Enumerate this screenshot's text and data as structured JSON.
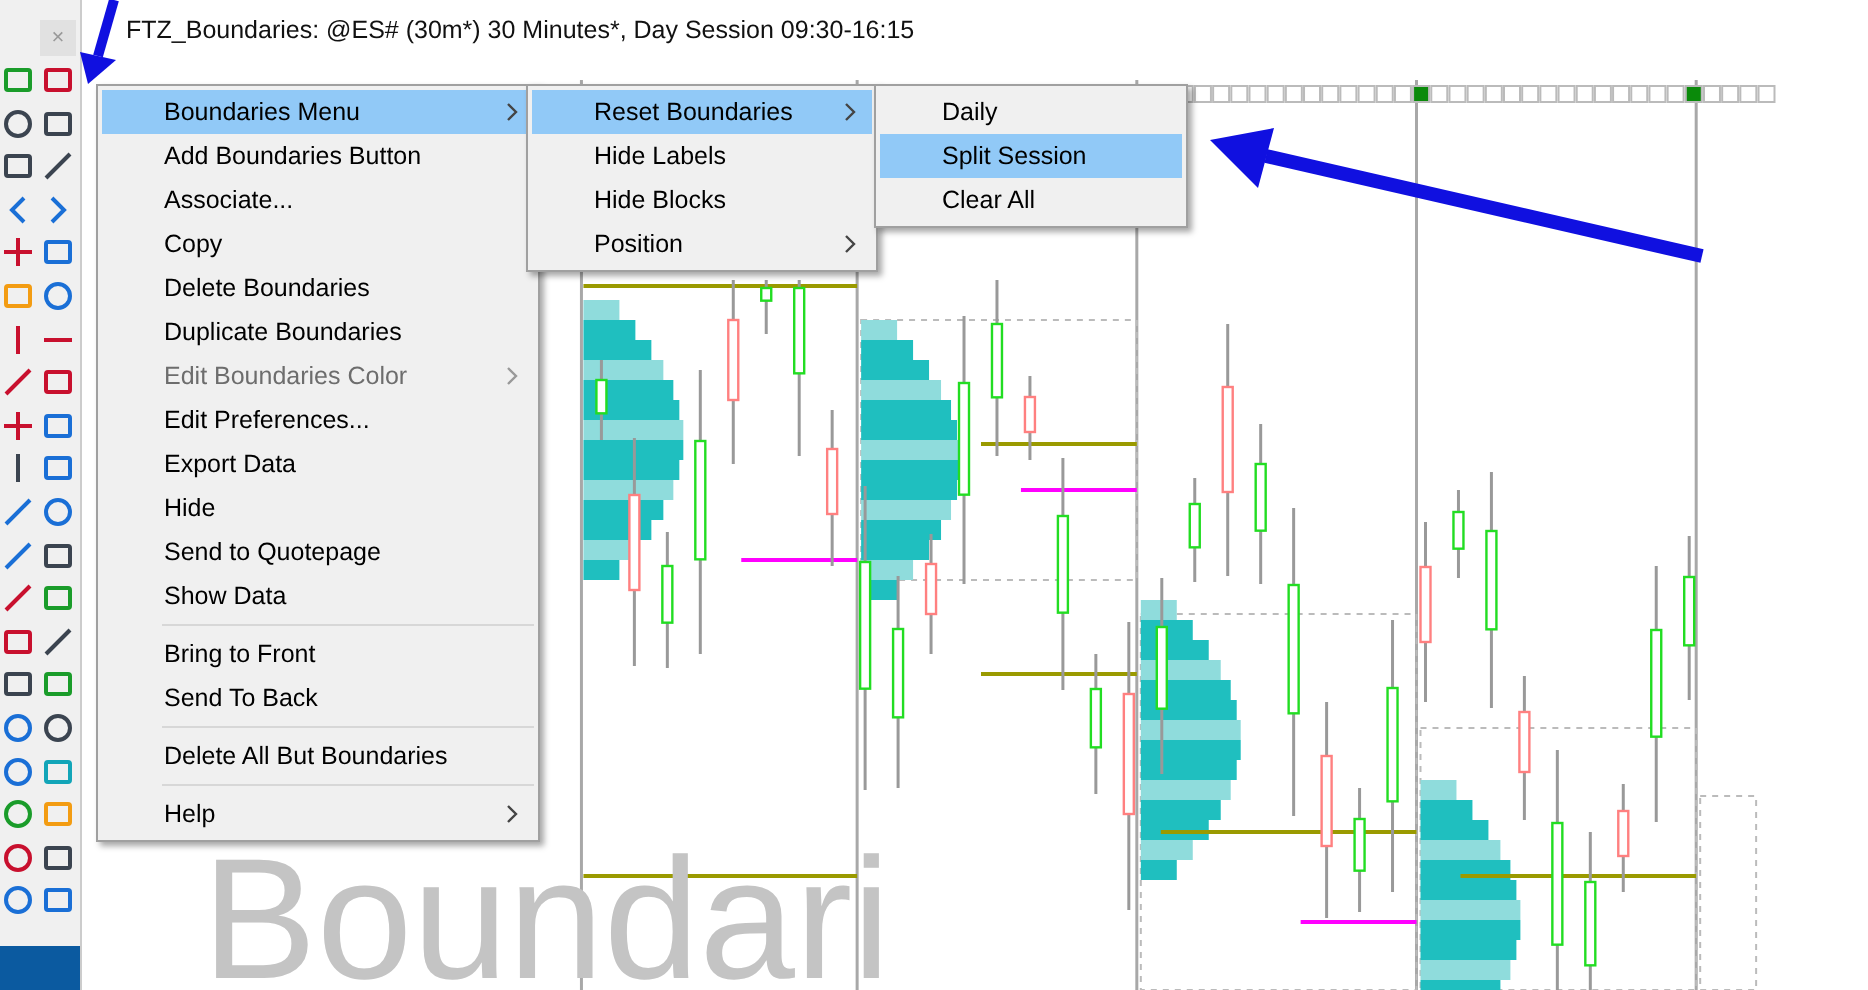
{
  "window": {
    "title": "FTZ_Boundaries: @ES# (30m*) 30 Minutes*, Day Session 09:30-16:15",
    "close_label": "×"
  },
  "context_menu": {
    "items": [
      {
        "kind": "item",
        "label": "Boundaries Menu",
        "selected": true,
        "disabled": false,
        "submenu": true
      },
      {
        "kind": "item",
        "label": "Add Boundaries Button",
        "selected": false,
        "disabled": false,
        "submenu": false
      },
      {
        "kind": "item",
        "label": "Associate...",
        "selected": false,
        "disabled": false,
        "submenu": false
      },
      {
        "kind": "item",
        "label": "Copy",
        "selected": false,
        "disabled": false,
        "submenu": false
      },
      {
        "kind": "item",
        "label": "Delete Boundaries",
        "selected": false,
        "disabled": false,
        "submenu": false
      },
      {
        "kind": "item",
        "label": "Duplicate Boundaries",
        "selected": false,
        "disabled": false,
        "submenu": false
      },
      {
        "kind": "item",
        "label": "Edit Boundaries Color",
        "selected": false,
        "disabled": true,
        "submenu": true
      },
      {
        "kind": "item",
        "label": "Edit Preferences...",
        "selected": false,
        "disabled": false,
        "submenu": false
      },
      {
        "kind": "item",
        "label": "Export Data",
        "selected": false,
        "disabled": false,
        "submenu": false
      },
      {
        "kind": "item",
        "label": "Hide",
        "selected": false,
        "disabled": false,
        "submenu": false
      },
      {
        "kind": "item",
        "label": "Send to Quotepage",
        "selected": false,
        "disabled": false,
        "submenu": false
      },
      {
        "kind": "item",
        "label": "Show Data",
        "selected": false,
        "disabled": false,
        "submenu": false
      },
      {
        "kind": "separator"
      },
      {
        "kind": "item",
        "label": "Bring to Front",
        "selected": false,
        "disabled": false,
        "submenu": false
      },
      {
        "kind": "item",
        "label": "Send To Back",
        "selected": false,
        "disabled": false,
        "submenu": false
      },
      {
        "kind": "separator"
      },
      {
        "kind": "item",
        "label": "Delete All But Boundaries",
        "selected": false,
        "disabled": false,
        "submenu": false
      },
      {
        "kind": "separator"
      },
      {
        "kind": "item",
        "label": "Help",
        "selected": false,
        "disabled": false,
        "submenu": true
      }
    ]
  },
  "boundaries_submenu": {
    "items": [
      {
        "kind": "item",
        "label": "Reset Boundaries",
        "selected": true,
        "disabled": false,
        "submenu": true
      },
      {
        "kind": "item",
        "label": "Hide Labels",
        "selected": false,
        "disabled": false,
        "submenu": false
      },
      {
        "kind": "item",
        "label": "Hide Blocks",
        "selected": false,
        "disabled": false,
        "submenu": false
      },
      {
        "kind": "item",
        "label": "Position",
        "selected": false,
        "disabled": false,
        "submenu": true
      }
    ]
  },
  "reset_submenu": {
    "items": [
      {
        "kind": "item",
        "label": "Daily",
        "selected": false,
        "disabled": false,
        "submenu": false
      },
      {
        "kind": "item",
        "label": "Split Session",
        "selected": true,
        "disabled": false,
        "submenu": false
      },
      {
        "kind": "item",
        "label": "Clear All",
        "selected": false,
        "disabled": false,
        "submenu": false
      }
    ]
  },
  "chart": {
    "watermark": "Boundari"
  }
}
